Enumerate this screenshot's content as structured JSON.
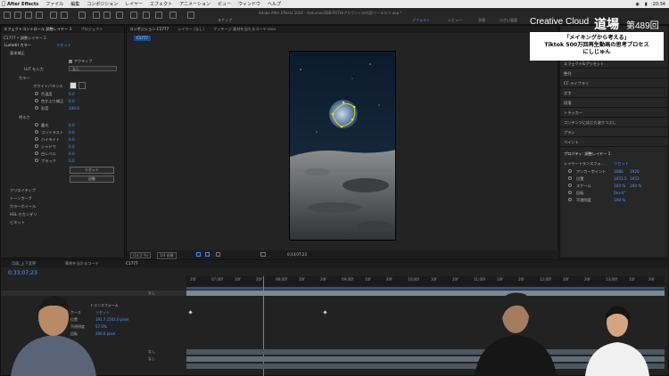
{
  "menubar": {
    "app": "After Effects",
    "items": [
      "ファイル",
      "編集",
      "コンポジション",
      "レイヤー",
      "エフェクト",
      "アニメーション",
      "ビュー",
      "ウィンドウ",
      "ヘルプ"
    ],
    "status": "20:34"
  },
  "toolbar": {
    "window_title": "Adobe After Effects 2024 - /Volumes/EBB-PUTH/アカウントの内容/リールのフ.aep *",
    "snap_label": "スナップ",
    "workspaces": [
      "デフォルト",
      "レビュー",
      "学習",
      "小さい画面"
    ]
  },
  "effects_panel": {
    "tabs": [
      "エフェクトコントロール 調整レイヤー 1",
      "プロジェクト"
    ],
    "breadcrumb": "C1777 • 調整レイヤー 1",
    "effect_name": "Lumetri カラー",
    "reset_label": "リセット",
    "rows": [
      {
        "label": "基本補正",
        "value": ""
      },
      {
        "label": "アクティブ",
        "value": ""
      },
      {
        "label": "LUT を入力",
        "value": "なし"
      },
      {
        "label": "カラー",
        "value": ""
      },
      {
        "label": "ホワイトバランス",
        "value": ""
      },
      {
        "label": "色温度",
        "value": "0.0"
      },
      {
        "label": "色かぶり補正",
        "value": "0.0"
      },
      {
        "label": "彩度",
        "value": "100.0"
      },
      {
        "label": "明るさ",
        "value": ""
      },
      {
        "label": "露光",
        "value": "0.0"
      },
      {
        "label": "コントラスト",
        "value": "0.0"
      },
      {
        "label": "ハイライト",
        "value": "0.0"
      },
      {
        "label": "シャドウ",
        "value": "0.0"
      },
      {
        "label": "白レベル",
        "value": "0.0"
      },
      {
        "label": "ブラック",
        "value": "0.0"
      }
    ],
    "buttons": [
      "リセット",
      "自動"
    ],
    "sections": [
      "クリエイティブ",
      "トーンカーブ",
      "カラーホイール",
      "HSL セカンダリ",
      "ビネット"
    ]
  },
  "comp_panel": {
    "tabs": [
      "コンポジション C1777",
      "レイヤー (なし)",
      "フッテージ 素材を当たるコーヤ.mov"
    ],
    "comp_tag": "C1777",
    "zoom": "(14.2 %)",
    "resolution": "1/4 画質",
    "timecode": "0;33;07;23"
  },
  "right_panel": {
    "items": [
      "エフェクト&プリセット",
      "整列",
      "CC ライブラリ",
      "文字",
      "段落",
      "トラッカー",
      "コンテンツに応じた塗りつぶし",
      "ブラシ",
      "ペイント"
    ],
    "properties_title": "プロパティ: 調整レイヤー 1",
    "transform_label": "レイヤートランスフォ...",
    "transform_reset": "リセット",
    "props": [
      {
        "label": "アンカーポイント",
        "v1": "1080",
        "v2": "1920"
      },
      {
        "label": "位置",
        "v1": "1053.5",
        "v2": "1953"
      },
      {
        "label": "スケール",
        "v1": "100 %",
        "v2": "100 %"
      },
      {
        "label": "回転",
        "v1": "0x+0°",
        "v2": ""
      },
      {
        "label": "不透明度",
        "v1": "100 %",
        "v2": ""
      }
    ]
  },
  "timeline": {
    "tabs": [
      "月面_上下変更",
      "素材を当たるコーヤ",
      "C1777"
    ],
    "timecode": "0;33;07;23",
    "ruler": [
      "20f",
      "07;00f",
      "10f",
      "20f",
      "08;00f",
      "10f",
      "20f",
      "09;00f",
      "10f",
      "20f",
      "10;00f",
      "10f",
      "20f",
      "11;00f",
      "10f",
      "20f",
      "12;00f",
      "10f",
      "20f",
      "13;00f",
      "10f",
      "20f"
    ],
    "layer_props": [
      "トランスフォーム",
      "ケース",
      "位置",
      "不透明度",
      "回転"
    ],
    "layer_values": [
      "リセット",
      "191.7,1501.0 pixel",
      "57.0%",
      "200.0 pixel"
    ],
    "parent_none": "なし"
  },
  "caption": {
    "brand": "Creative Cloud",
    "kanji": "道場",
    "episode": "第489回",
    "line1": "「メイキングから考える」",
    "line2": "Tiktok 500万回再生動画の思考プロセス",
    "line3": "にしじゅん"
  },
  "colors": {
    "accent": "#3d8cff",
    "value_blue": "#4f9bff",
    "bg": "#1d1d1d"
  }
}
